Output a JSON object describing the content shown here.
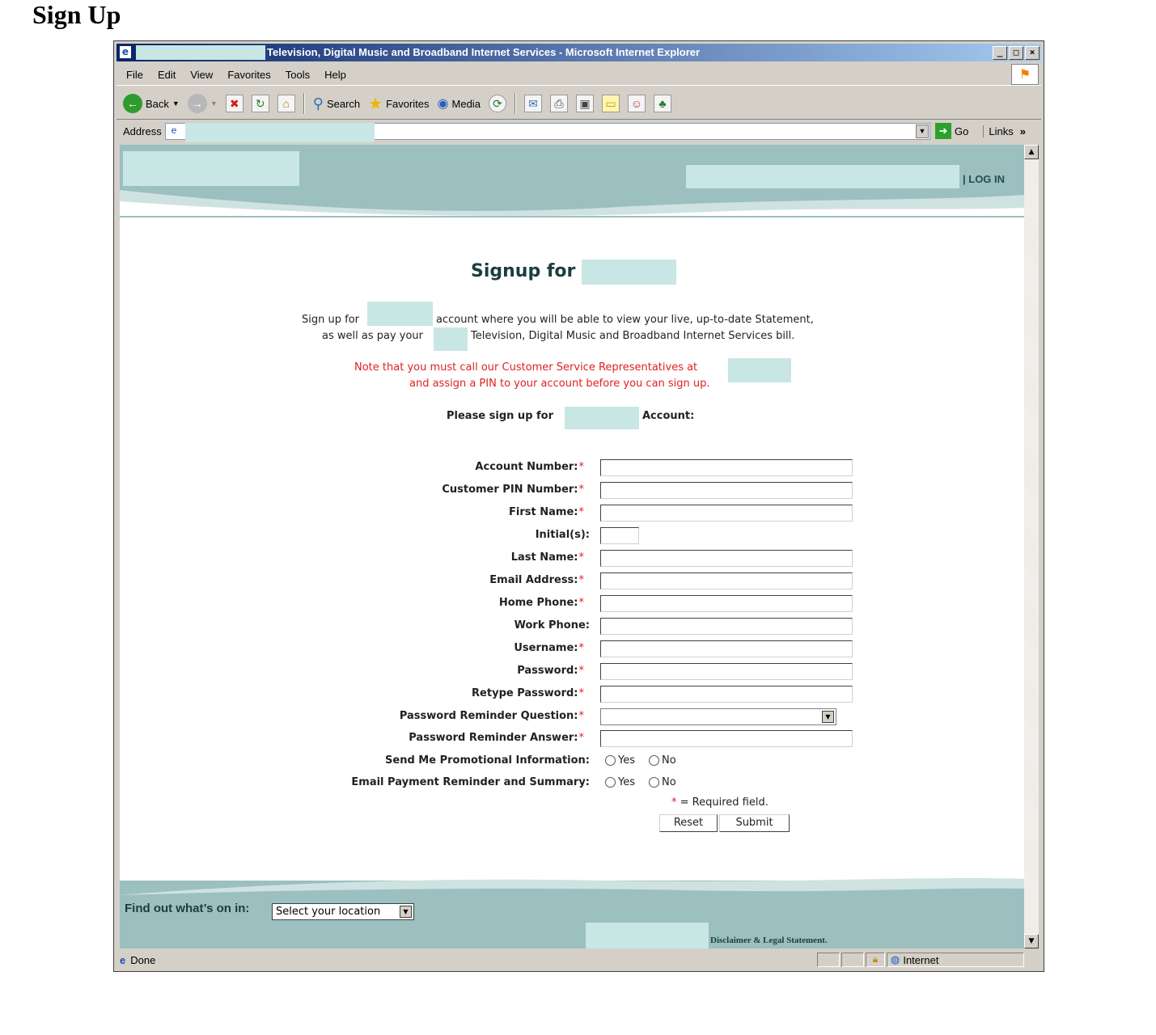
{
  "page": {
    "heading": "Sign Up"
  },
  "window": {
    "title": "Television, Digital Music and Broadband Internet Services - Microsoft Internet Explorer",
    "controls": [
      "_",
      "□",
      "×"
    ]
  },
  "menu": [
    "File",
    "Edit",
    "View",
    "Favorites",
    "Tools",
    "Help"
  ],
  "toolbar": {
    "back": "Back",
    "search": "Search",
    "favorites": "Favorites",
    "media": "Media"
  },
  "address": {
    "label": "Address",
    "go": "Go",
    "links": "Links"
  },
  "site_header": {
    "login": "| LOG IN"
  },
  "signup": {
    "title": "Signup for",
    "intro_line1_a": "Sign up for",
    "intro_line1_b": "account where you will be able to view your live, up-to-date Statement,",
    "intro_line2_a": "as well as pay your",
    "intro_line2_b": "Television, Digital Music and Broadband Internet Services bill.",
    "note_line1": "Note that you must call our Customer Service Representatives at",
    "note_line2": "and assign a PIN to your account before you can sign up.",
    "please_a": "Please sign up for",
    "please_b": "Account:"
  },
  "form": {
    "fields": [
      {
        "label": "Account Number:",
        "required": "*"
      },
      {
        "label": "Customer PIN Number:",
        "required": "*"
      },
      {
        "label": "First Name:",
        "required": "*"
      },
      {
        "label": "Initial(s):",
        "required": ""
      },
      {
        "label": "Last Name:",
        "required": "*"
      },
      {
        "label": "Email Address:",
        "required": "*"
      },
      {
        "label": "Home Phone:",
        "required": "*"
      },
      {
        "label": "Work Phone:",
        "required": ""
      },
      {
        "label": "Username:",
        "required": "*"
      },
      {
        "label": "Password:",
        "required": "*"
      },
      {
        "label": "Retype Password:",
        "required": "*"
      },
      {
        "label": "Password Reminder Question:",
        "required": "*"
      },
      {
        "label": "Password Reminder Answer:",
        "required": "*"
      },
      {
        "label": "Send Me Promotional Information:",
        "required": ""
      },
      {
        "label": "Email Payment Reminder and Summary:",
        "required": ""
      }
    ],
    "yes": "Yes",
    "no": "No",
    "required_star": "*",
    "required_note": "= Required field.",
    "reset": "Reset",
    "submit": "Submit"
  },
  "footer": {
    "find_label": "Find out what’s on in:",
    "location_select": "Select your location",
    "disclaimer": "Disclaimer & Legal Statement."
  },
  "statusbar": {
    "status": "Done",
    "zone": "Internet"
  }
}
